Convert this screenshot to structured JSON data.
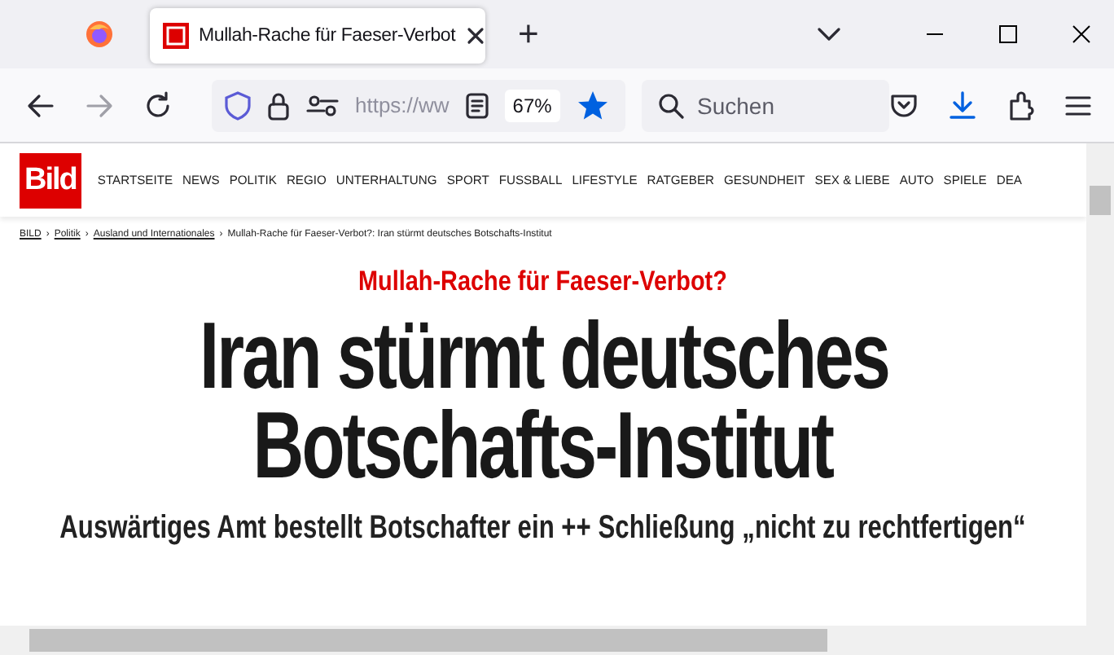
{
  "window": {
    "tabs": [
      {
        "title": "Mullah-Rache für Faeser-Verbot",
        "selected": true
      }
    ],
    "new_tab": "+"
  },
  "toolbar": {
    "url": "https://ww",
    "zoom": "67%",
    "bookmarked": true,
    "search": {
      "placeholder": "Suchen"
    }
  },
  "site": {
    "logo": "Bild",
    "nav": [
      "STARTSEITE",
      "NEWS",
      "POLITIK",
      "REGIO",
      "UNTERHALTUNG",
      "SPORT",
      "FUSSBALL",
      "LIFESTYLE",
      "RATGEBER",
      "GESUNDHEIT",
      "SEX & LIEBE",
      "AUTO",
      "SPIELE",
      "DEA"
    ],
    "breadcrumb": {
      "separator": "›",
      "items": [
        {
          "text": "BILD",
          "kind": "link"
        },
        {
          "text": "Politik",
          "kind": "link"
        },
        {
          "text": "Ausland und Internationales",
          "kind": "link"
        },
        {
          "text": "Mullah-Rache für Faeser-Verbot?: Iran stürmt deutsches Botschafts-Institut",
          "kind": "current"
        }
      ]
    },
    "article": {
      "kicker": "Mullah-Rache für Faeser-Verbot?",
      "headline": [
        "Iran stürmt deutsches",
        "Botschafts-Institut"
      ],
      "subheadline": "Auswärtiges Amt bestellt Botschafter ein ++ Schließung „nicht zu rechtfertigen“"
    }
  }
}
